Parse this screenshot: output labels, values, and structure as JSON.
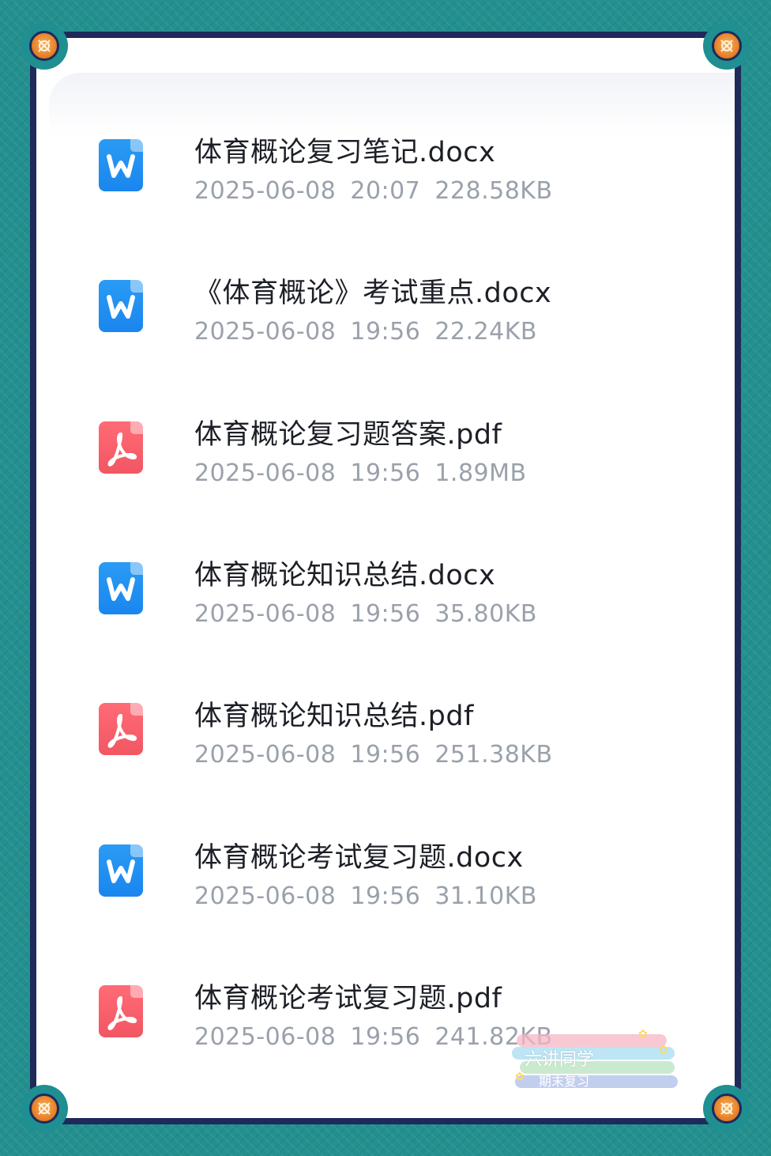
{
  "colors": {
    "frame": "#23908f",
    "frame_border": "#1d2a5a",
    "corner_knob": "#e8822b",
    "word_icon": "#1a86ee",
    "pdf_icon": "#f25663",
    "name_text": "#1c1f26",
    "meta_text": "#9aa1ab"
  },
  "files": [
    {
      "name": "体育概论复习笔记.docx",
      "date": "2025-06-08",
      "time": "20:07",
      "size": "228.58KB",
      "type": "word",
      "icon": "word-icon"
    },
    {
      "name": "《体育概论》考试重点.docx",
      "date": "2025-06-08",
      "time": "19:56",
      "size": "22.24KB",
      "type": "word",
      "icon": "word-icon"
    },
    {
      "name": "体育概论复习题答案.pdf",
      "date": "2025-06-08",
      "time": "19:56",
      "size": "1.89MB",
      "type": "pdf",
      "icon": "pdf-icon"
    },
    {
      "name": "体育概论知识总结.docx",
      "date": "2025-06-08",
      "time": "19:56",
      "size": "35.80KB",
      "type": "word",
      "icon": "word-icon"
    },
    {
      "name": "体育概论知识总结.pdf",
      "date": "2025-06-08",
      "time": "19:56",
      "size": "251.38KB",
      "type": "pdf",
      "icon": "pdf-icon"
    },
    {
      "name": "体育概论考试复习题.docx",
      "date": "2025-06-08",
      "time": "19:56",
      "size": "31.10KB",
      "type": "word",
      "icon": "word-icon"
    },
    {
      "name": "体育概论考试复习题.pdf",
      "date": "2025-06-08",
      "time": "19:56",
      "size": "241.82KB",
      "type": "pdf",
      "icon": "pdf-icon"
    }
  ],
  "watermark": {
    "title": "六讲同学",
    "subtitle": "期末复习"
  }
}
